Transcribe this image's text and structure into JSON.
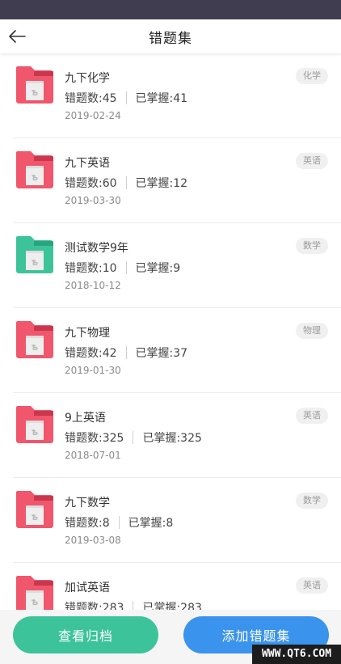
{
  "header": {
    "title": "错题集"
  },
  "colors": {
    "red_folder": "#f0566c",
    "green_folder": "#3cc39a",
    "archive_button": "#3cc39a",
    "add_button": "#3a93ec"
  },
  "items": [
    {
      "title": "九下化学",
      "errors": "错题数:45",
      "mastered": "已掌握:41",
      "date": "2019-02-24",
      "tag": "化学",
      "icon": "chemistry-folder-icon",
      "color": "red"
    },
    {
      "title": "九下英语",
      "errors": "错题数:60",
      "mastered": "已掌握:12",
      "date": "2019-03-30",
      "tag": "英语",
      "icon": "english-folder-icon",
      "color": "red"
    },
    {
      "title": "测试数学9年",
      "errors": "错题数:10",
      "mastered": "已掌握:9",
      "date": "2018-10-12",
      "tag": "数学",
      "icon": "math-folder-icon",
      "color": "green"
    },
    {
      "title": "九下物理",
      "errors": "错题数:42",
      "mastered": "已掌握:37",
      "date": "2019-01-30",
      "tag": "物理",
      "icon": "physics-folder-icon",
      "color": "red"
    },
    {
      "title": "9上英语",
      "errors": "错题数:325",
      "mastered": "已掌握:325",
      "date": "2018-07-01",
      "tag": "英语",
      "icon": "english-folder-icon",
      "color": "red"
    },
    {
      "title": "九下数学",
      "errors": "错题数:8",
      "mastered": "已掌握:8",
      "date": "2019-03-08",
      "tag": "数学",
      "icon": "math-folder-icon",
      "color": "red"
    },
    {
      "title": "加试英语",
      "errors": "错题数:283",
      "mastered": "已掌握:283",
      "date": "",
      "tag": "英语",
      "icon": "english-folder-icon",
      "color": "red"
    }
  ],
  "footer": {
    "archive_label": "查看归档",
    "add_label": "添加错题集"
  },
  "watermark": "WWW.QT6.COM"
}
